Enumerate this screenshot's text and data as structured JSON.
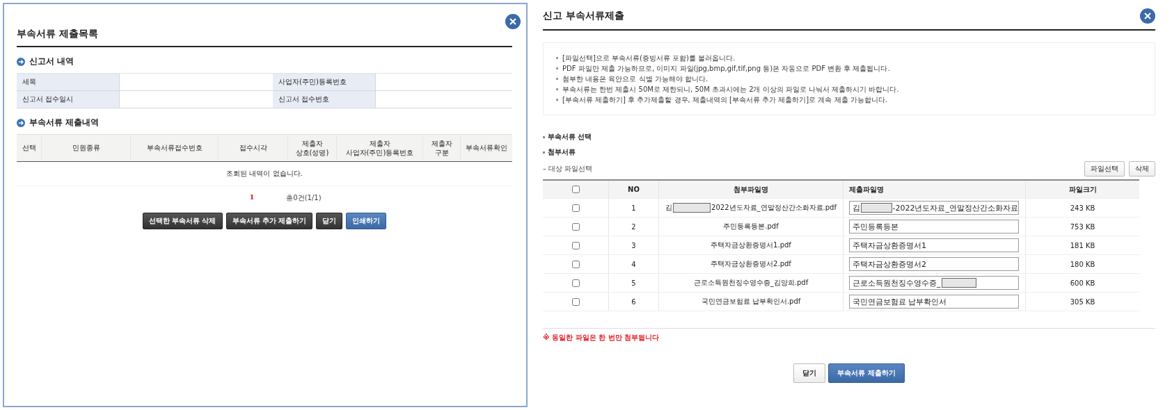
{
  "left": {
    "title": "부속서류 제출목록",
    "report_heading": "신고서 내역",
    "report_fields": [
      {
        "label": "세목"
      },
      {
        "label": "사업자(주민)등록번호"
      },
      {
        "label": "신고서 접수일시"
      },
      {
        "label": "신고서 접수번호"
      }
    ],
    "list_heading": "부속서류 제출내역",
    "columns": [
      "선택",
      "민원종류",
      "부속서류접수번호",
      "접수시각",
      "제출자\n상호(성명)",
      "제출자\n사업자(주민)등록번호",
      "제출자\n구분",
      "부속서류확인"
    ],
    "empty_message": "조회된 내역이 없습니다.",
    "pages": [
      {
        "label": "1",
        "selected": true
      }
    ],
    "total": "총0건(1/1)",
    "buttons": [
      {
        "label": "선택한 부속서류 삭제",
        "kind": "dark"
      },
      {
        "label": "부속서류 추가 제출하기",
        "kind": "dark"
      },
      {
        "label": "닫기",
        "kind": "dark"
      },
      {
        "label": "인쇄하기",
        "kind": "primary"
      }
    ]
  },
  "right": {
    "title": "신고 부속서류제출",
    "notes": [
      "[파일선택]으로 부속서류(증빙서류 포함)를 불러옵니다.",
      "PDF 파일만 제출 가능하므로, 이미지 파일(jpg,bmp,gif,tif,png 등)은 자동으로 PDF 변환 후 제출됩니다.",
      "첨부한 내용은 육안으로 식별 가능해야 합니다.",
      "부속서류는 한번 제출시 50M로 제한되니, 50M 초과시에는 2개 이상의 파일로 나눠서 제출하시기 바랍니다.",
      "[부속서류 제출하기] 후 추가제출할 경우, 제출내역의 [부속서류 추가 제출하기]로 계속 제출 가능합니다."
    ],
    "headings": [
      "부속서류 선택",
      "첨부서류"
    ],
    "file_select_label": "– 대상 파일선택",
    "tool_buttons": [
      "파일선택",
      "삭제"
    ],
    "all_checked": false,
    "columns": [
      "NO",
      "첨부파일명",
      "제출파일명",
      "파일크기"
    ],
    "files": [
      {
        "checked": false,
        "no": "1",
        "name": [
          {
            "kind": "text",
            "text": "김"
          },
          {
            "kind": "redacted"
          },
          {
            "kind": "text",
            "text": "2022년도자료_연말정산간소화자료.pdf"
          }
        ],
        "submit": [
          {
            "kind": "text",
            "text": "김"
          },
          {
            "kind": "redacted"
          },
          {
            "kind": "text",
            "text": "-2022년도자료_연말정산간소화자료"
          }
        ],
        "size": "243 KB"
      },
      {
        "checked": false,
        "no": "2",
        "name": [
          {
            "kind": "text",
            "text": "주민등록등본.pdf"
          }
        ],
        "submit": [
          {
            "kind": "text",
            "text": "주민등록등본"
          }
        ],
        "size": "753 KB"
      },
      {
        "checked": false,
        "no": "3",
        "name": [
          {
            "kind": "text",
            "text": "주택자금상환증명서1.pdf"
          }
        ],
        "submit": [
          {
            "kind": "text",
            "text": "주택자금상환증명서1"
          }
        ],
        "size": "181 KB"
      },
      {
        "checked": false,
        "no": "4",
        "name": [
          {
            "kind": "text",
            "text": "주택자금상환증명서2.pdf"
          }
        ],
        "submit": [
          {
            "kind": "text",
            "text": "주택자금상환증명서2"
          }
        ],
        "size": "180 KB"
      },
      {
        "checked": false,
        "no": "5",
        "name": [
          {
            "kind": "text",
            "text": "근로소득원천징수영수증_김양희.pdf"
          }
        ],
        "submit": [
          {
            "kind": "text",
            "text": "근로소득원천징수영수증_"
          },
          {
            "kind": "redacted"
          }
        ],
        "size": "600 KB"
      },
      {
        "checked": false,
        "no": "6",
        "name": [
          {
            "kind": "text",
            "text": "국민연금보험료 납부확인서.pdf"
          }
        ],
        "submit": [
          {
            "kind": "text",
            "text": "국민연금보험료 납부확인서"
          }
        ],
        "size": "305 KB"
      }
    ],
    "warning": "※ 동일한 파일은 한 번만 첨부됩니다",
    "buttons": [
      {
        "label": "닫기",
        "kind": "light"
      },
      {
        "label": "부속서류 제출하기",
        "kind": "primary"
      }
    ]
  }
}
